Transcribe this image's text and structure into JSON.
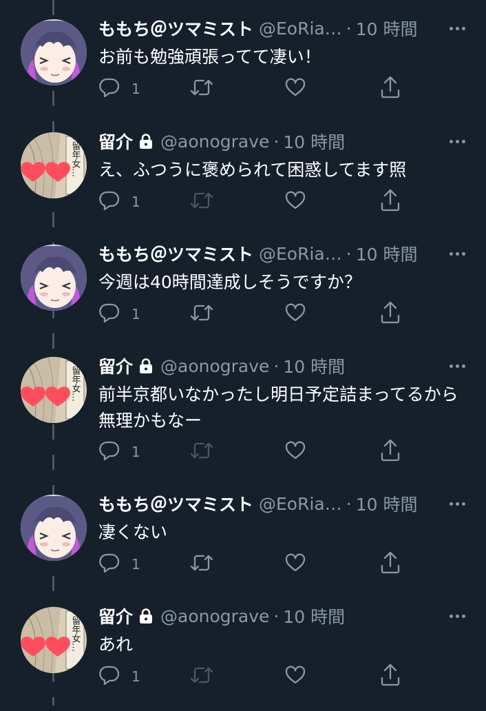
{
  "tweets": [
    {
      "name": "ももち＠ツマミスト",
      "handle": "@EoRia…",
      "dot": "·",
      "time": "10 時間",
      "text": "お前も勉強頑張ってて凄い！",
      "reply_count": "1",
      "avatar": "girl-avatar",
      "locked": false
    },
    {
      "name": "留介",
      "handle": "@aonograve",
      "dot": "·",
      "time": "10 時間",
      "text": "え、ふつうに褒められて困惑してます照",
      "reply_count": "1",
      "avatar": "manga-avatar",
      "locked": true
    },
    {
      "name": "ももち＠ツマミスト",
      "handle": "@EoRia…",
      "dot": "·",
      "time": "10 時間",
      "text": "今週は40時間達成しそうですか？",
      "reply_count": "1",
      "avatar": "girl-avatar",
      "locked": false
    },
    {
      "name": "留介",
      "handle": "@aonograve",
      "dot": "·",
      "time": "10 時間",
      "text": "前半京都いなかったし明日予定詰まってるから無理かもなー",
      "reply_count": "1",
      "avatar": "manga-avatar",
      "locked": true
    },
    {
      "name": "ももち＠ツマミスト",
      "handle": "@EoRia…",
      "dot": "·",
      "time": "10 時間",
      "text": "凄くない",
      "reply_count": "1",
      "avatar": "girl-avatar",
      "locked": false
    },
    {
      "name": "留介",
      "handle": "@aonograve",
      "dot": "·",
      "time": "10 時間",
      "text": "あれ",
      "reply_count": "1",
      "avatar": "manga-avatar",
      "locked": true
    }
  ],
  "avatar_art": {
    "manga_text": "あの留年女…"
  },
  "icons": [
    "reply-icon",
    "retweet-icon",
    "like-icon",
    "share-icon",
    "lock-icon",
    "more-icon"
  ],
  "colors": {
    "background": "#15202b",
    "text": "#ffffff",
    "secondary": "#8b98a5",
    "thread_line": "#4b5867"
  }
}
